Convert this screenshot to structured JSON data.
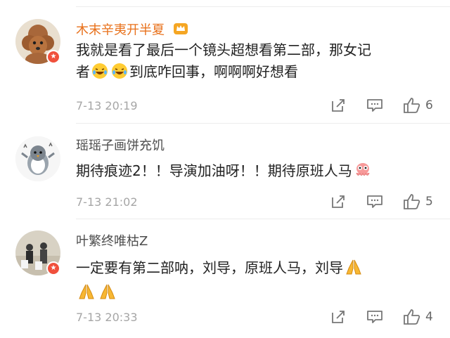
{
  "comments": [
    {
      "username": "木末辛夷开半夏",
      "text_line1": "我就是看了最后一个镜头超想看第二部，那女记",
      "text_line2_start": "者",
      "text_line2_end": "到底咋回事，啊啊啊好想看",
      "time": "7-13 20:19",
      "likes": "6",
      "username_color": "#e8701a",
      "avatar": "brown-poodle-avatar",
      "emoji": "laughing-tears-emoji"
    },
    {
      "username": "瑶瑶子画饼充饥",
      "text_line1": "期待痕迹2！！导演加油呀！！期待原班人马",
      "time": "7-13 21:02",
      "likes": "5",
      "username_color": "#4d4d4d",
      "avatar": "penguin-sticker-avatar",
      "emoji": "pink-octopus-emoji"
    },
    {
      "username": "叶繁终唯枯Z",
      "text_line1": "一定要有第二部呐，刘导，原班人马，刘导",
      "time": "7-13 20:33",
      "likes": "4",
      "username_color": "#4d4d4d",
      "avatar": "group-photo-avatar",
      "emoji": "praying-hands-emoji"
    }
  ],
  "icons": {
    "forward": "forward-icon",
    "comment": "comment-icon",
    "like": "like-icon",
    "crown": "crown-badge-icon",
    "verified": "verified-badge-icon"
  }
}
